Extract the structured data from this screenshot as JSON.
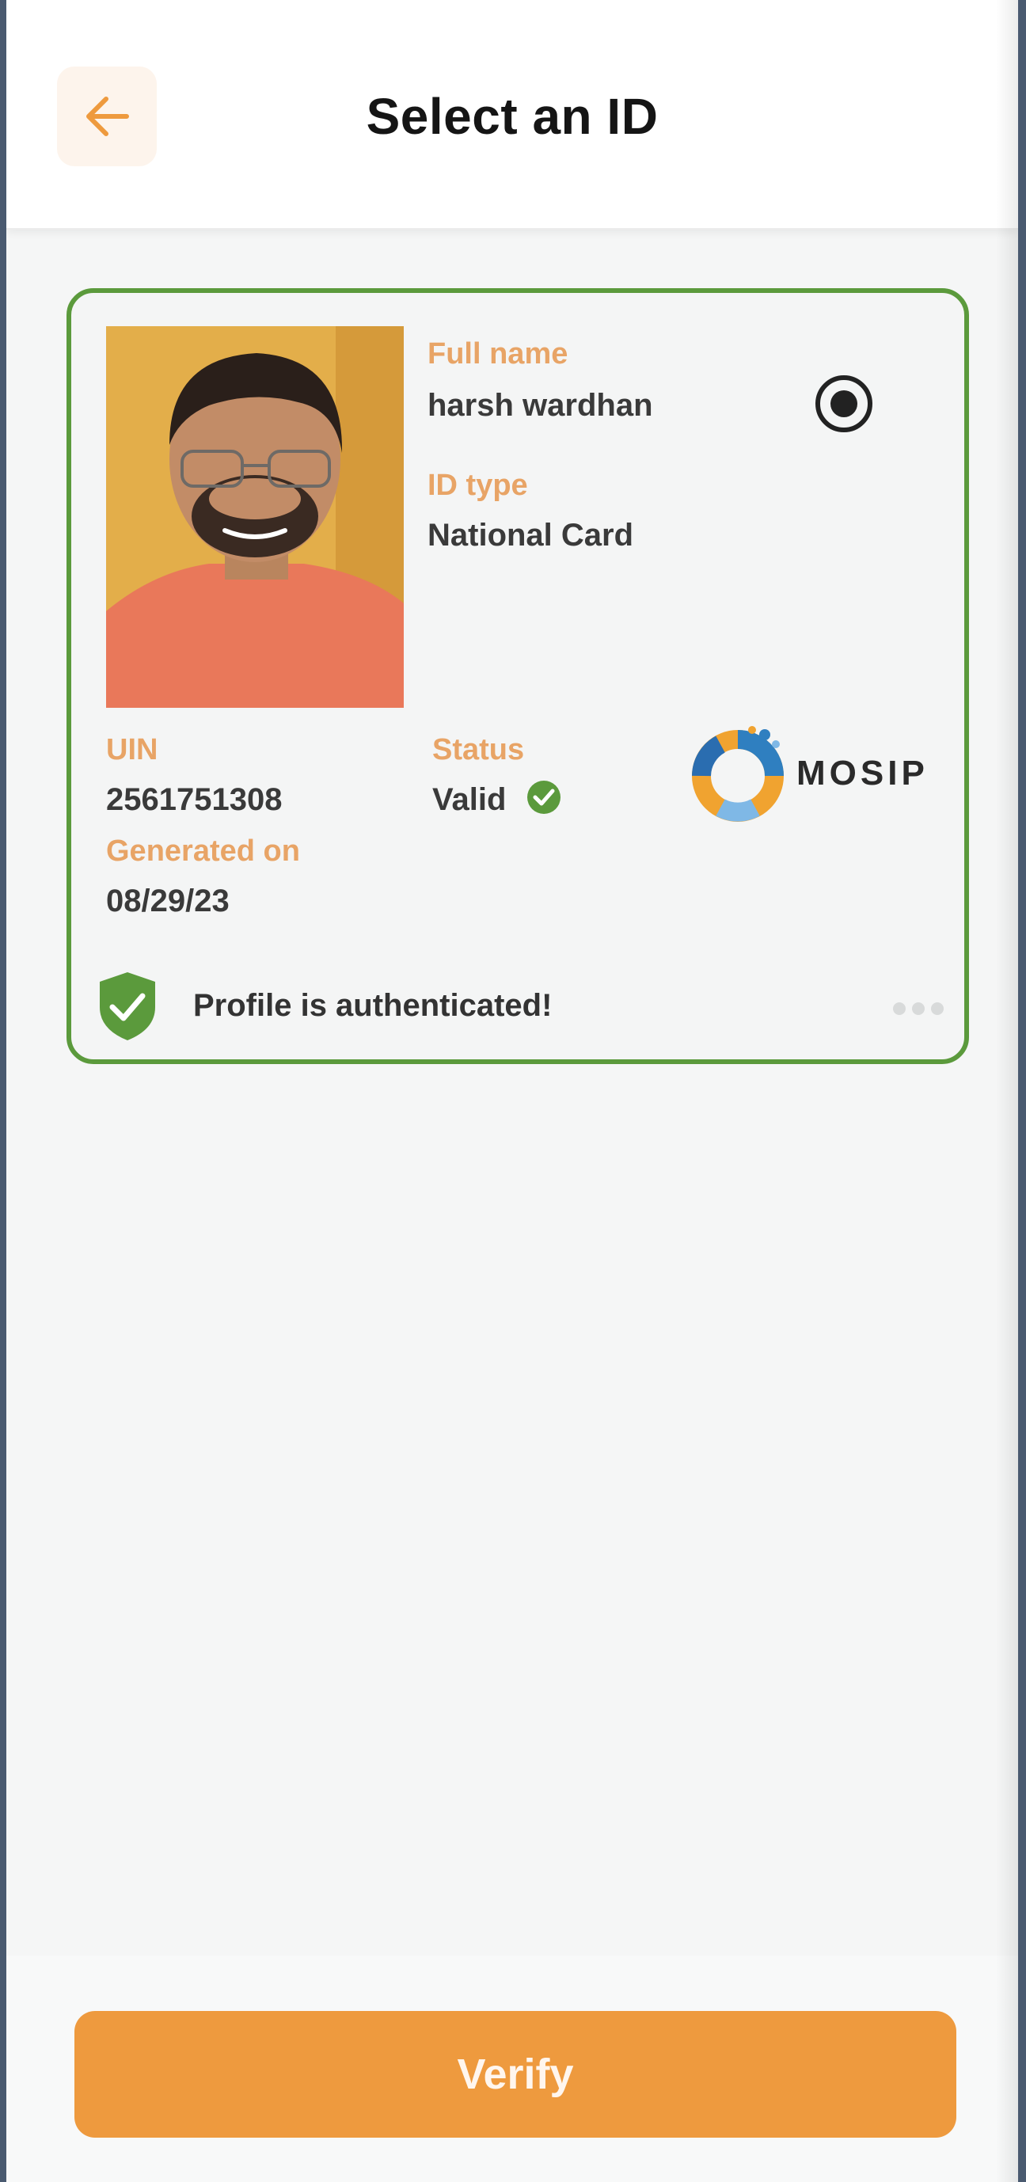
{
  "header": {
    "title": "Select an ID",
    "back_icon": "arrow-left-icon"
  },
  "card": {
    "full_name_label": "Full name",
    "full_name": "harsh wardhan",
    "id_type_label": "ID type",
    "id_type": "National Card",
    "uin_label": "UIN",
    "uin": "2561751308",
    "status_label": "Status",
    "status": "Valid",
    "generated_on_label": "Generated on",
    "generated_on": "08/29/23",
    "issuer_logo_text": "MOSIP",
    "auth_message": "Profile is authenticated!",
    "selected": true
  },
  "footer": {
    "verify_label": "Verify"
  },
  "colors": {
    "accent": "#ee9a3e",
    "label": "#e8a466",
    "card_border": "#5b9a3c",
    "valid": "#5b9a3c"
  }
}
